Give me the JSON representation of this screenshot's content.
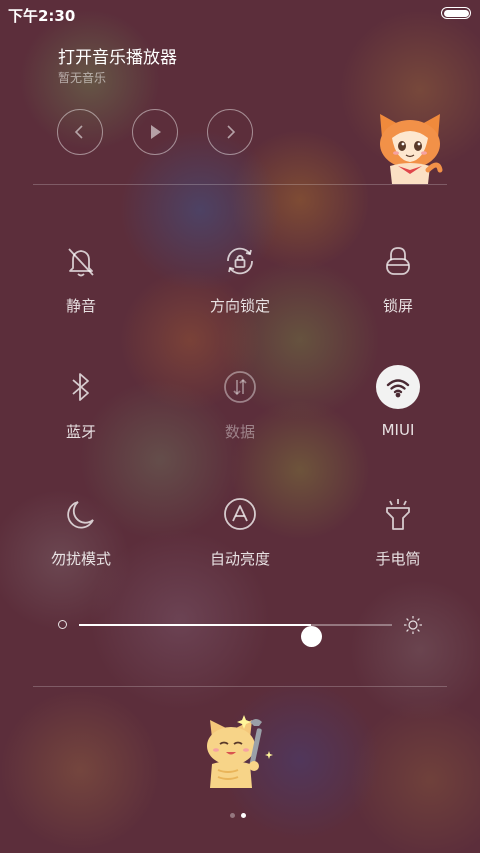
{
  "status_bar": {
    "time": "下午2:30"
  },
  "music": {
    "title": "打开音乐播放器",
    "subtitle": "暂无音乐",
    "controls": [
      "previous-icon",
      "play-icon",
      "next-icon"
    ]
  },
  "toggles": [
    {
      "label": "静音",
      "icon": "bell-muted-icon",
      "active": false,
      "disabled": false
    },
    {
      "label": "方向锁定",
      "icon": "rotation-lock-icon",
      "active": false,
      "disabled": false
    },
    {
      "label": "锁屏",
      "icon": "lock-icon",
      "active": false,
      "disabled": false
    },
    {
      "label": "蓝牙",
      "icon": "bluetooth-icon",
      "active": false,
      "disabled": false
    },
    {
      "label": "数据",
      "icon": "mobile-data-icon",
      "active": false,
      "disabled": true
    },
    {
      "label": "MIUI",
      "icon": "wifi-icon",
      "active": true,
      "disabled": false
    },
    {
      "label": "勿扰模式",
      "icon": "moon-icon",
      "active": false,
      "disabled": false
    },
    {
      "label": "自动亮度",
      "icon": "auto-brightness-icon",
      "active": false,
      "disabled": false
    },
    {
      "label": "手电筒",
      "icon": "flashlight-icon",
      "active": false,
      "disabled": false
    }
  ],
  "brightness": {
    "value": 0.74
  },
  "pager": {
    "count": 2,
    "active_index": 1
  },
  "colors": {
    "accent": "#ffffff",
    "background": "#5c2e3b",
    "cat_orange": "#f08a3c"
  }
}
